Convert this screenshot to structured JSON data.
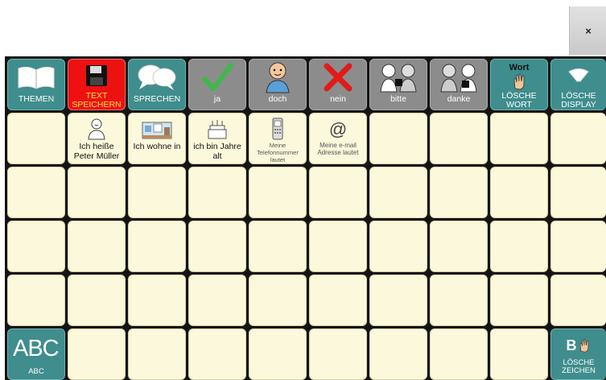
{
  "window": {
    "close_label": "×"
  },
  "toolbar": {
    "themen": "THEMEN",
    "text_speichern": "TEXT SPEICHERN",
    "sprechen": "SPRECHEN",
    "ja": "ja",
    "doch": "doch",
    "nein": "nein",
    "bitte": "bitte",
    "danke": "danke",
    "loesche_wort_icon_text": "Wort",
    "loesche_wort": "LÖSCHE WORT",
    "loesche_display": "LÖSCHE DISPLAY"
  },
  "phrases": {
    "name": "Ich heiße Peter Müller",
    "wohne": "Ich wohne in",
    "alter": "ich bin Jahre alt",
    "telefon": "Meine Telefonnummer lautet",
    "email_symbol": "@",
    "email": "Meine e-mail Adresse lautet"
  },
  "bottom": {
    "abc_big": "ABC",
    "abc_label": "ABC",
    "loesche_zeichen_icon_text": "B",
    "loesche_zeichen": "LÖSCHE ZEICHEN"
  },
  "colors": {
    "teal": "#3f8d8d",
    "grey": "#8c8c8c",
    "red": "#ee1111",
    "cream": "#fbf8dc",
    "grid_background": "#141414"
  }
}
